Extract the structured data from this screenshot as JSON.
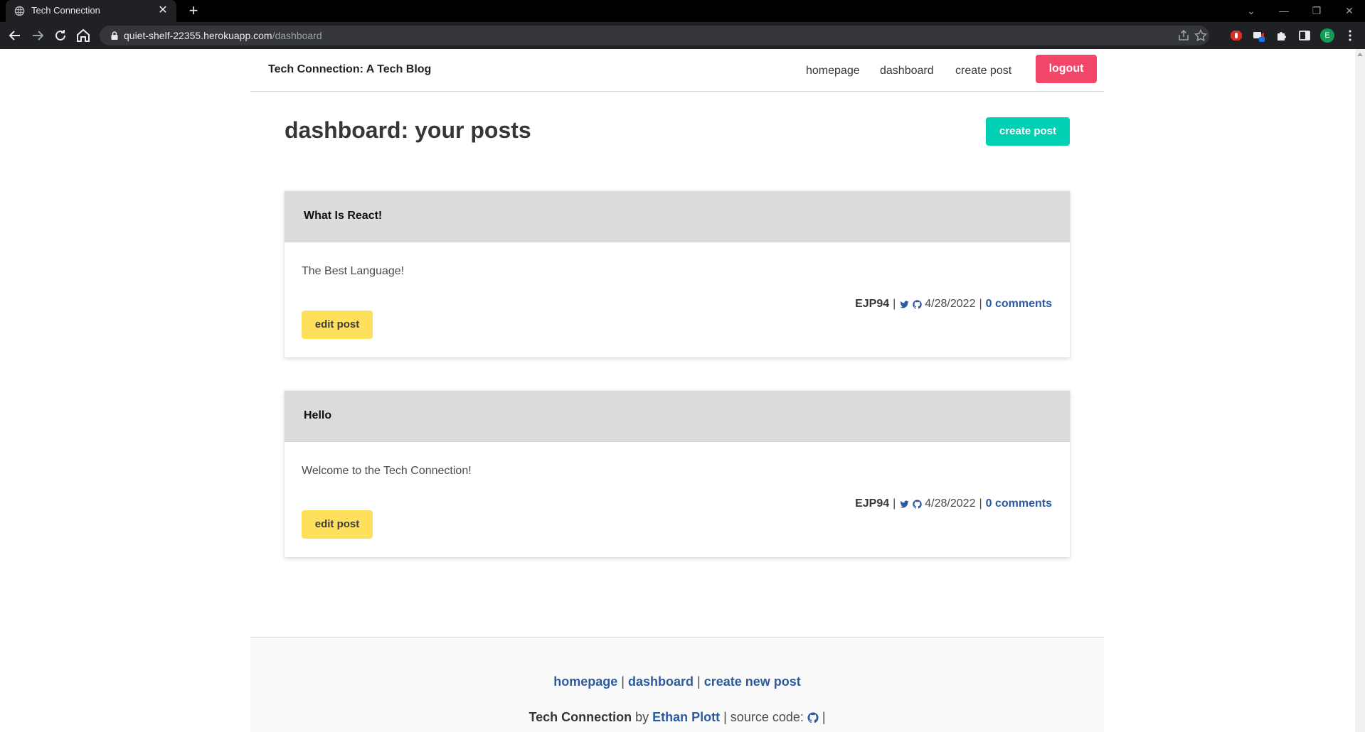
{
  "browser": {
    "tab_title": "Tech Connection",
    "url_host": "quiet-shelf-22355.herokuapp.com",
    "url_path": "/dashboard",
    "profile_initial": "E"
  },
  "nav": {
    "brand": "Tech Connection: A Tech Blog",
    "links": [
      "homepage",
      "dashboard",
      "create post"
    ],
    "logout": "logout"
  },
  "dashboard": {
    "title": "dashboard: your posts",
    "create_button": "create post"
  },
  "posts": [
    {
      "title": "What Is React!",
      "body": "The Best Language!",
      "author": "EJP94",
      "date": "4/28/2022",
      "comments": "0 comments",
      "edit_label": "edit post"
    },
    {
      "title": "Hello",
      "body": "Welcome to the Tech Connection!",
      "author": "EJP94",
      "date": "4/28/2022",
      "comments": "0 comments",
      "edit_label": "edit post"
    }
  ],
  "footer": {
    "links": [
      "homepage",
      "dashboard",
      "create new post"
    ],
    "brand": "Tech Connection",
    "by": "by",
    "author": "Ethan Plott",
    "source_label": "| source code:"
  },
  "colors": {
    "logout": "#f14668",
    "create": "#00d1b2",
    "edit": "#ffe05d",
    "link": "#2c5aa0"
  }
}
